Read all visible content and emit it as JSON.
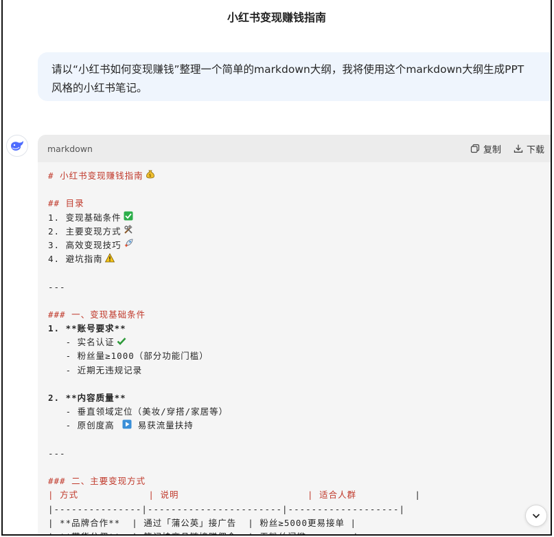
{
  "page": {
    "title": "小红书变现赚钱指南"
  },
  "user_message": {
    "line1": "请以“小红书如何变现赚钱”整理一个简单的markdown大纲，我将使用这个markdown大纲生成PPT",
    "line2": "风格的小红书笔记。"
  },
  "code_block": {
    "language": "markdown",
    "copy_label": "复制",
    "download_label": "下载",
    "lines": [
      "# 小红书变现赚钱指南",
      "",
      "## 目录",
      "1. 变现基础条件",
      "2. 主要变现方式",
      "3. 高效变现技巧",
      "4. 避坑指南",
      "",
      "---",
      "",
      "### 一、变现基础条件",
      "1. **账号要求**",
      "   - 实名认证",
      "   - 粉丝量≥1000（部分功能门槛）",
      "   - 近期无违规记录",
      "",
      "2. **内容质量**",
      "   - 垂直领域定位（美妆/穿搭/家居等）",
      "   - 原创度高",
      "",
      "---",
      "",
      "### 二、主要变现方式",
      "| 方式           | 说明                   | 适合人群            |",
      "|----------------|------------------------|---------------------|",
      "| **品牌合作**   | 通过「蒲公英」接广告   | 粉丝≥5000更易接单  |",
      "| **带货分佣**   | 笔记挂商品链接赚佣金   | 无粉丝门槛         |"
    ],
    "p_h1": "# ",
    "p_h2": "## ",
    "p_h3": "### ",
    "p_pipe": "| ",
    "p_sep": "|",
    "h1_text": "小红书变现赚钱指南",
    "h2_text": "目录",
    "toc": [
      "1. 变现基础条件",
      "2. 主要变现方式",
      "3. 高效变现技巧",
      "4. 避坑指南"
    ],
    "hr": "---",
    "sec1_title": "一、变现基础条件",
    "sec1_item1": "1. **账号要求**",
    "sec1_item1_bullets": [
      "   - 实名认证",
      "   - 粉丝量≥1000（部分功能门槛）",
      "   - 近期无违规记录"
    ],
    "sec1_item2": "2. **内容质量**",
    "sec1_item2_bullets": [
      "   - 垂直领域定位（美妆/穿搭/家居等）",
      "   - 原创度高",
      "易获流量扶持"
    ],
    "sec2_title": "二、主要变现方式",
    "table_headers": [
      "方式",
      "说明",
      "适合人群"
    ],
    "table_header_pads": [
      "            ",
      "                      ",
      "          "
    ],
    "table_sep": "|---------------|-----------------------|-------------------|",
    "table_row1": "| **品牌合作**  | 通过「蒲公英」接广告  | 粉丝≥5000更易接单 |",
    "table_row2": "| **带货分佣**  | 笔记挂商品链接赚佣金  | 无粉丝门槛        |"
  },
  "icons": {
    "avatar": "deepseek-whale-icon",
    "copy": "copy-icon",
    "download": "download-icon",
    "scroll": "chevron-down-icon"
  },
  "colors": {
    "accent_blue": "#4d6bfe",
    "heading_red": "#c0392b",
    "bubble_bg": "#eff5fd",
    "code_bg": "#f5f5f5"
  }
}
